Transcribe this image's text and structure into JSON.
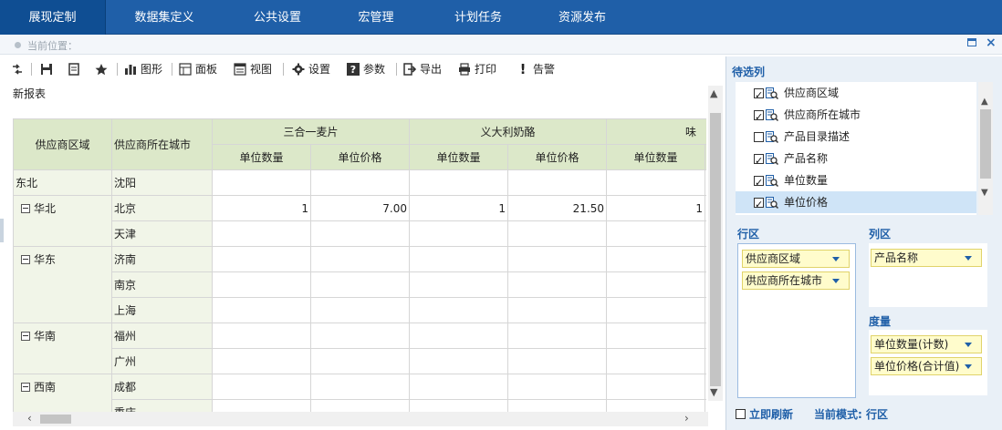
{
  "nav": {
    "tabs": [
      "展现定制",
      "数据集定义",
      "公共设置",
      "宏管理",
      "计划任务",
      "资源发布"
    ],
    "active": 0
  },
  "breadcrumb": {
    "label": "当前位置："
  },
  "toolbar": {
    "chart": "图形",
    "panel": "面板",
    "view": "视图",
    "settings": "设置",
    "params": "参数",
    "export": "导出",
    "print": "打印",
    "alert": "告警"
  },
  "report": {
    "name": "新报表"
  },
  "grid": {
    "row_headers": [
      "供应商区域",
      "供应商所在城市"
    ],
    "products": [
      "三合一麦片",
      "义大利奶酪",
      "味"
    ],
    "measures": [
      "单位数量",
      "单位价格"
    ],
    "rows": [
      {
        "region": "东北",
        "expand": false,
        "cities": [
          {
            "name": "沈阳",
            "vals": [
              "",
              "",
              "",
              "",
              ""
            ]
          }
        ]
      },
      {
        "region": "华北",
        "expand": true,
        "cities": [
          {
            "name": "北京",
            "vals": [
              "1",
              "7.00",
              "1",
              "21.50",
              "1"
            ]
          },
          {
            "name": "天津",
            "vals": [
              "",
              "",
              "",
              "",
              ""
            ]
          }
        ]
      },
      {
        "region": "华东",
        "expand": true,
        "cities": [
          {
            "name": "济南",
            "vals": [
              "",
              "",
              "",
              "",
              ""
            ]
          },
          {
            "name": "南京",
            "vals": [
              "",
              "",
              "",
              "",
              ""
            ]
          },
          {
            "name": "上海",
            "vals": [
              "",
              "",
              "",
              "",
              ""
            ]
          }
        ]
      },
      {
        "region": "华南",
        "expand": true,
        "cities": [
          {
            "name": "福州",
            "vals": [
              "",
              "",
              "",
              "",
              ""
            ]
          },
          {
            "name": "广州",
            "vals": [
              "",
              "",
              "",
              "",
              ""
            ]
          }
        ]
      },
      {
        "region": "西南",
        "expand": true,
        "cities": [
          {
            "name": "成都",
            "vals": [
              "",
              "",
              "",
              "",
              ""
            ]
          },
          {
            "name": "重庆",
            "vals": [
              "",
              "",
              "",
              "",
              ""
            ]
          }
        ]
      }
    ]
  },
  "panel": {
    "title": "待选列",
    "fields": [
      {
        "label": "供应商区域",
        "checked": true
      },
      {
        "label": "供应商所在城市",
        "checked": true
      },
      {
        "label": "产品目录描述",
        "checked": false
      },
      {
        "label": "产品名称",
        "checked": true
      },
      {
        "label": "单位数量",
        "checked": true
      },
      {
        "label": "单位价格",
        "checked": true
      }
    ],
    "selected_field": 5,
    "row_area": {
      "title": "行区",
      "items": [
        "供应商区域",
        "供应商所在城市"
      ]
    },
    "col_area": {
      "title": "列区",
      "items": [
        "产品名称"
      ]
    },
    "measure_area": {
      "title": "度量",
      "items": [
        "单位数量(计数)",
        "单位价格(合计值)"
      ]
    },
    "auto_refresh": "立即刷新",
    "mode": "当前模式: 行区"
  },
  "colors": {
    "nav": "#1f5fa8",
    "header": "#dce8c9",
    "chip": "#fffccc"
  }
}
